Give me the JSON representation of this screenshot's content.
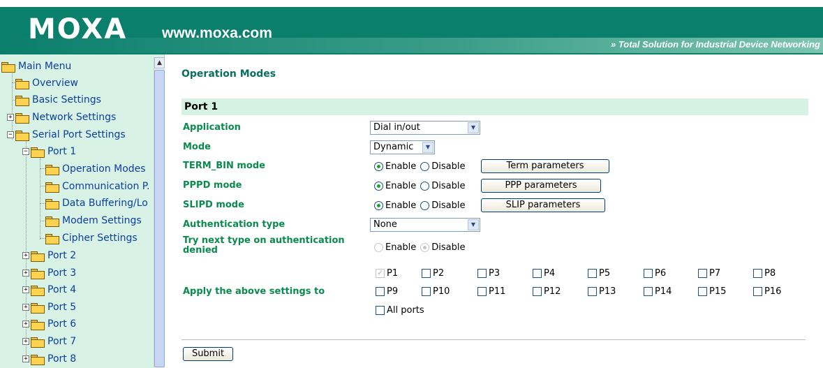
{
  "header": {
    "brand": "MOXA",
    "url": "www.moxa.com",
    "tagline": "» Total Solution for Industrial Device Networking"
  },
  "sidebar": {
    "items": [
      {
        "label": "Main Menu"
      },
      {
        "label": "Overview"
      },
      {
        "label": "Basic Settings"
      },
      {
        "label": "Network Settings"
      },
      {
        "label": "Serial Port Settings"
      },
      {
        "label": "Port 1"
      },
      {
        "label": "Operation Modes"
      },
      {
        "label": "Communication P."
      },
      {
        "label": "Data Buffering/Lo"
      },
      {
        "label": "Modem Settings"
      },
      {
        "label": "Cipher Settings"
      },
      {
        "label": "Port 2"
      },
      {
        "label": "Port 3"
      },
      {
        "label": "Port 4"
      },
      {
        "label": "Port 5"
      },
      {
        "label": "Port 6"
      },
      {
        "label": "Port 7"
      },
      {
        "label": "Port 8"
      }
    ]
  },
  "main": {
    "title": "Operation Modes",
    "section": "Port 1",
    "application": {
      "label": "Application",
      "value": "Dial in/out"
    },
    "mode": {
      "label": "Mode",
      "value": "Dynamic"
    },
    "term_bin": {
      "label": "TERM_BIN mode",
      "enable": "Enable",
      "disable": "Disable",
      "button": "Term parameters"
    },
    "pppd": {
      "label": "PPPD mode",
      "enable": "Enable",
      "disable": "Disable",
      "button": "PPP parameters"
    },
    "slipd": {
      "label": "SLIPD mode",
      "enable": "Enable",
      "disable": "Disable",
      "button": "SLIP parameters"
    },
    "auth_type": {
      "label": "Authentication type",
      "value": "None"
    },
    "try_next": {
      "label_line1": "Try next type on authentication",
      "label_line2": "denied",
      "enable": "Enable",
      "disable": "Disable"
    },
    "apply": {
      "label": "Apply the above settings to",
      "ports": [
        "P1",
        "P2",
        "P3",
        "P4",
        "P5",
        "P6",
        "P7",
        "P8",
        "P9",
        "P10",
        "P11",
        "P12",
        "P13",
        "P14",
        "P15",
        "P16"
      ],
      "all_ports": "All ports"
    },
    "submit": "Submit"
  }
}
